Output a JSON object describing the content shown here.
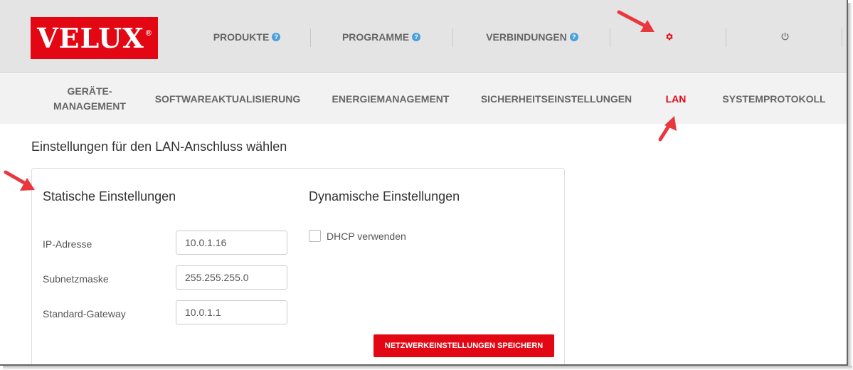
{
  "brand": {
    "logo_text": "VELUX",
    "registered_mark": "®"
  },
  "top_nav": {
    "items": [
      {
        "label": "PRODUKTE",
        "help": "?"
      },
      {
        "label": "PROGRAMME",
        "help": "?"
      },
      {
        "label": "VERBINDUNGEN",
        "help": "?"
      }
    ],
    "settings_icon": "gear-icon",
    "logout_icon": "power-icon"
  },
  "sub_nav": {
    "items": [
      {
        "label": "GERÄTE-MANAGEMENT"
      },
      {
        "label": "SOFTWAREAKTUALISIERUNG"
      },
      {
        "label": "ENERGIEMANAGEMENT"
      },
      {
        "label": "SICHERHEITSEINSTELLUNGEN"
      },
      {
        "label": "LAN"
      },
      {
        "label": "SYSTEMPROTOKOLL"
      }
    ],
    "active_label": "LAN"
  },
  "page": {
    "heading": "Einstellungen für den LAN-Anschluss wählen",
    "static": {
      "title": "Statische Einstellungen",
      "ip_label": "IP-Adresse",
      "ip_value": "10.0.1.16",
      "subnet_label": "Subnetzmaske",
      "subnet_value": "255.255.255.0",
      "gateway_label": "Standard-Gateway",
      "gateway_value": "10.0.1.1"
    },
    "dynamic": {
      "title": "Dynamische Einstellungen",
      "dhcp_label": "DHCP verwenden",
      "dhcp_checked": false
    },
    "save_label": "NETZWERKEINSTELLUNGEN SPEICHERN"
  },
  "colors": {
    "brand_red": "#e30613",
    "help_blue": "#4aa0dc",
    "annotation_red": "#e8383d"
  }
}
